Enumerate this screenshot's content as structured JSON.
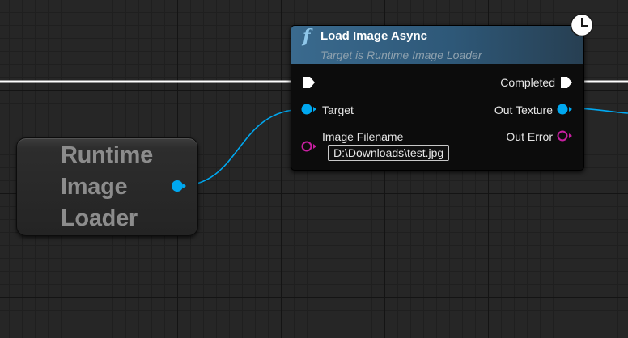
{
  "canvas": {
    "grid_minor": "#1f1f1f",
    "grid_major": "#141414",
    "background": "#262626"
  },
  "colors": {
    "object_pin": "#00a8f0",
    "string_pin": "#c71fa0",
    "exec_pin": "#ffffff",
    "header_blue": "#3a6a8e"
  },
  "variable_node": {
    "label_lines": [
      "Runtime",
      "Image",
      "Loader"
    ],
    "output_pin_icon": "object-pin-icon"
  },
  "function_node": {
    "icon": "function-icon",
    "icon_glyph": "f",
    "title": "Load Image Async",
    "subtitle": "Target is Runtime Image Loader",
    "latent_icon": "clock-icon",
    "inputs": {
      "exec": {
        "icon": "exec-pin-icon"
      },
      "target": {
        "label": "Target",
        "icon": "object-pin-icon"
      },
      "image_filename": {
        "label": "Image Filename",
        "value": "D:\\Downloads\\test.jpg",
        "icon": "string-pin-icon"
      }
    },
    "outputs": {
      "completed": {
        "label": "Completed",
        "icon": "exec-pin-icon"
      },
      "out_texture": {
        "label": "Out Texture",
        "icon": "object-pin-icon"
      },
      "out_error": {
        "label": "Out Error",
        "icon": "string-pin-icon"
      }
    }
  }
}
